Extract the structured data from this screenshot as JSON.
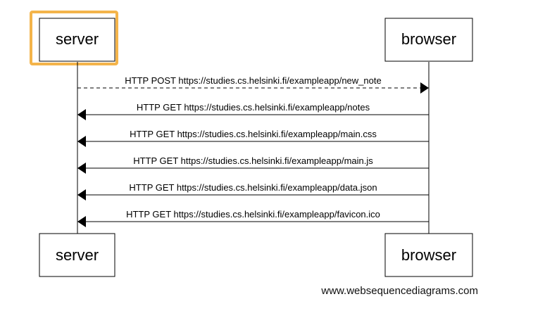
{
  "diagram": {
    "actors": {
      "server": "server",
      "browser": "browser"
    },
    "highlight_color": "#f4b44a",
    "messages": [
      {
        "from": "server",
        "to": "browser",
        "style": "dashed",
        "label": "HTTP POST https://studies.cs.helsinki.fi/exampleapp/new_note"
      },
      {
        "from": "browser",
        "to": "server",
        "style": "solid",
        "label": "HTTP GET https://studies.cs.helsinki.fi/exampleapp/notes"
      },
      {
        "from": "browser",
        "to": "server",
        "style": "solid",
        "label": "HTTP GET https://studies.cs.helsinki.fi/exampleapp/main.css"
      },
      {
        "from": "browser",
        "to": "server",
        "style": "solid",
        "label": "HTTP GET https://studies.cs.helsinki.fi/exampleapp/main.js"
      },
      {
        "from": "browser",
        "to": "server",
        "style": "solid",
        "label": "HTTP GET https://studies.cs.helsinki.fi/exampleapp/data.json"
      },
      {
        "from": "browser",
        "to": "server",
        "style": "solid",
        "label": "HTTP GET https://studies.cs.helsinki.fi/exampleapp/favicon.ico"
      }
    ]
  },
  "footer": {
    "text": "www.websequencediagrams.com"
  }
}
